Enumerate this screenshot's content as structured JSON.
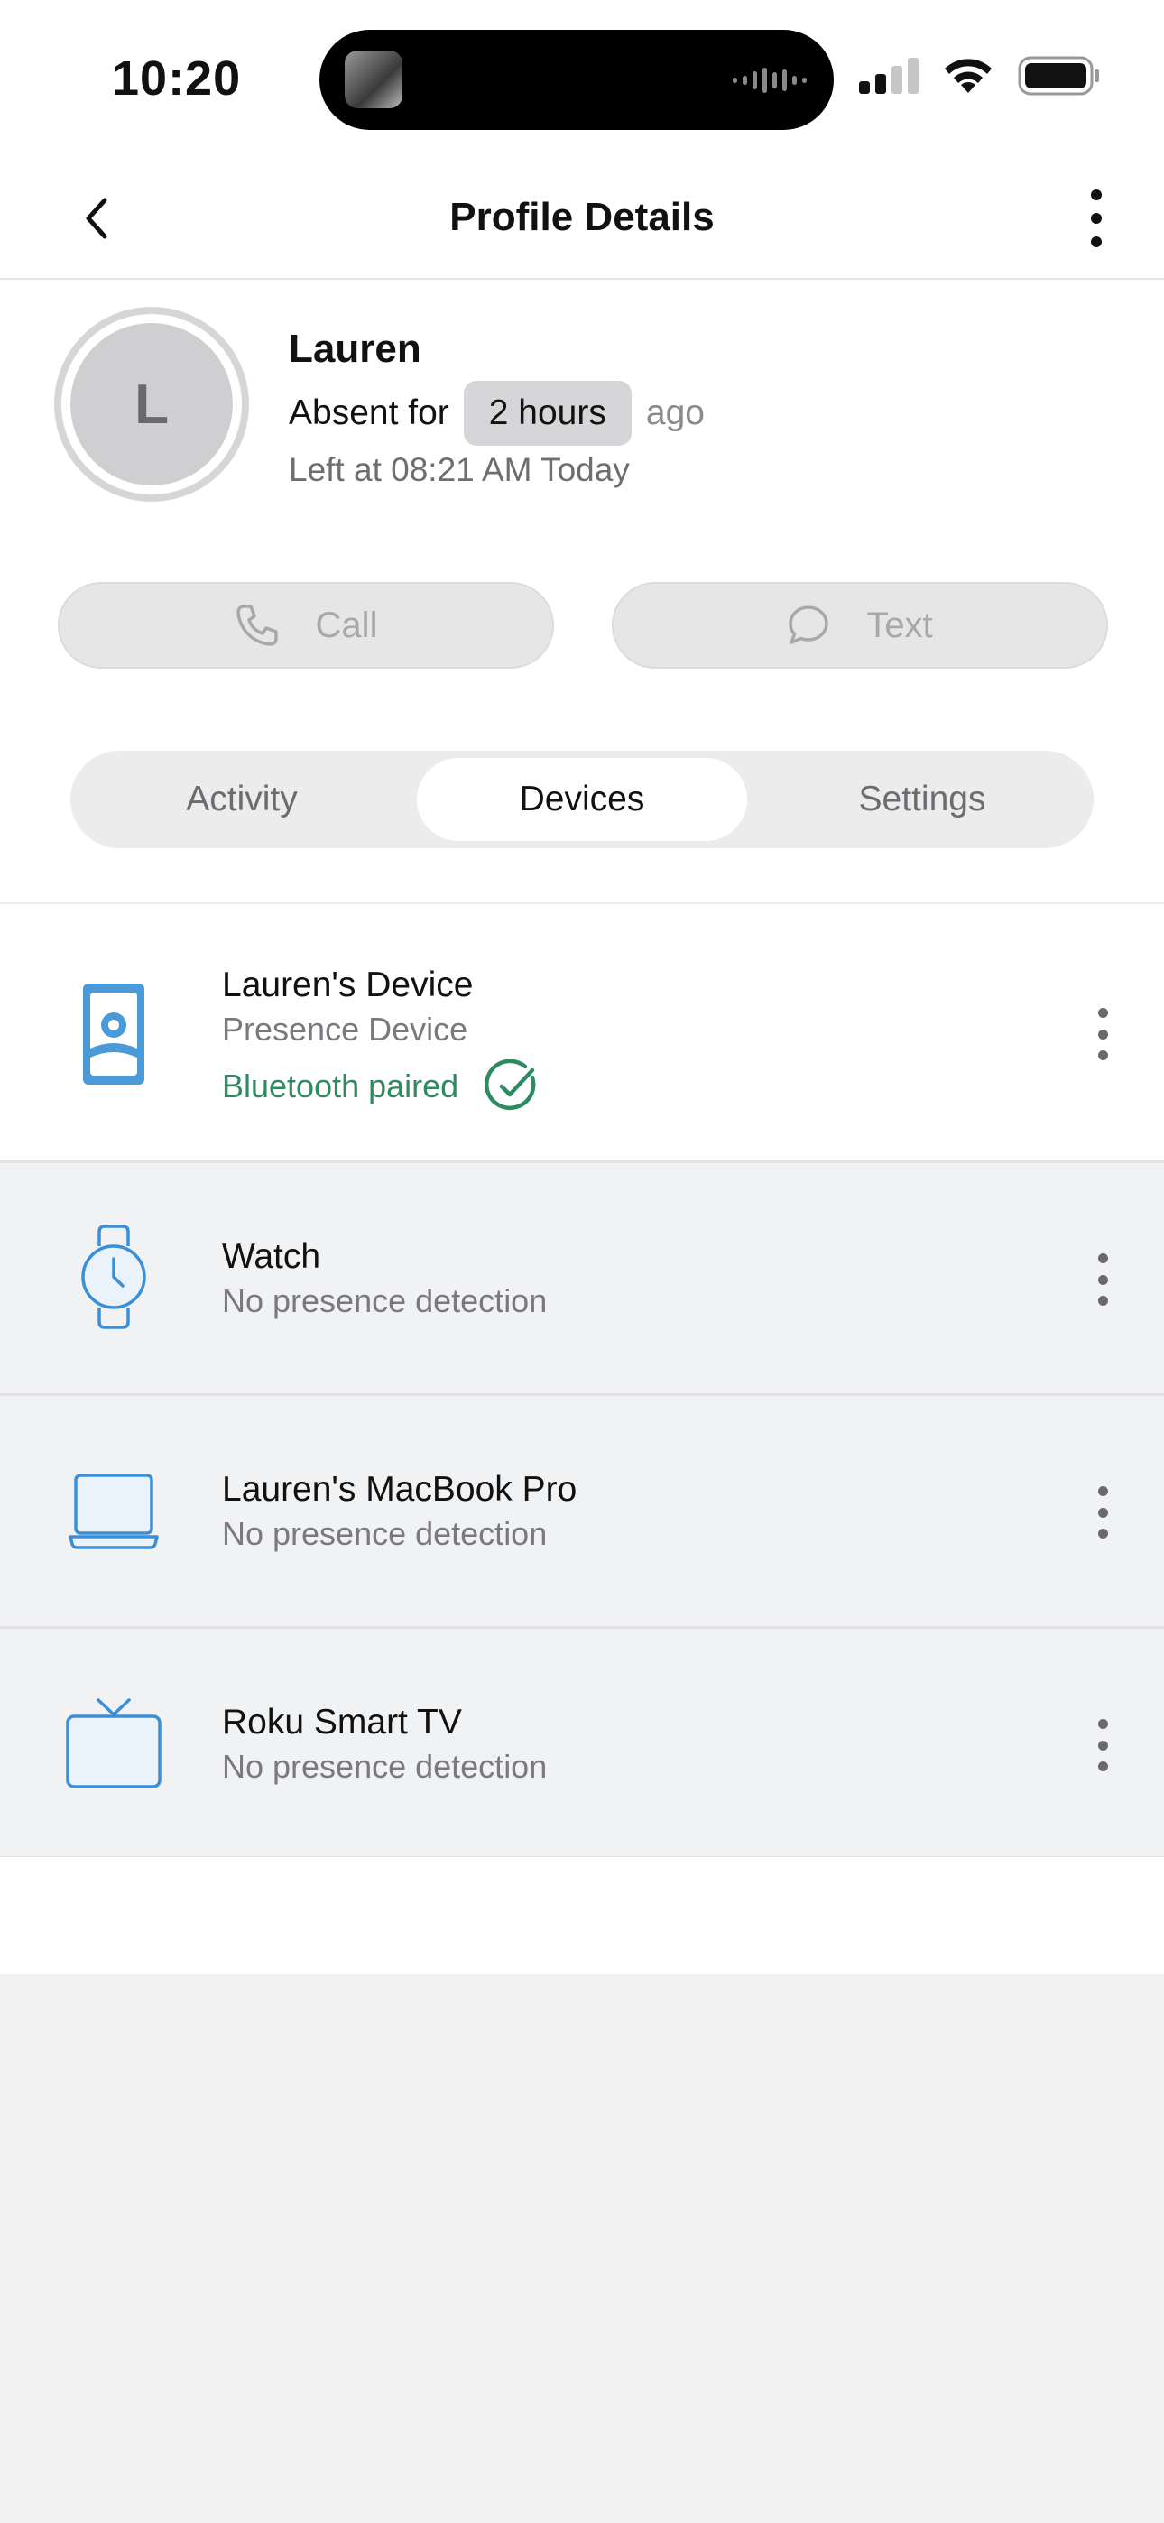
{
  "status_bar": {
    "time": "10:20"
  },
  "header": {
    "title": "Profile Details"
  },
  "profile": {
    "avatar_initial": "L",
    "name": "Lauren",
    "absent_label": "Absent for",
    "absent_duration": "2 hours",
    "absent_suffix": "ago",
    "left_at": "Left at 08:21 AM Today"
  },
  "actions": {
    "call_label": "Call",
    "text_label": "Text"
  },
  "tabs": [
    {
      "label": "Activity"
    },
    {
      "label": "Devices",
      "selected": true
    },
    {
      "label": "Settings"
    }
  ],
  "devices": [
    {
      "name": "Lauren's Device",
      "subtitle": "Presence Device",
      "status": "Bluetooth paired",
      "icon": "presence-device-icon"
    },
    {
      "name": "Watch",
      "subtitle": "No presence detection",
      "icon": "watch-icon"
    },
    {
      "name": "Lauren's MacBook Pro",
      "subtitle": "No presence detection",
      "icon": "laptop-icon"
    },
    {
      "name": "Roku Smart TV",
      "subtitle": "No presence detection",
      "icon": "tv-icon"
    }
  ],
  "colors": {
    "accent_blue": "#3b8fd6",
    "status_green": "#2e8b61"
  }
}
